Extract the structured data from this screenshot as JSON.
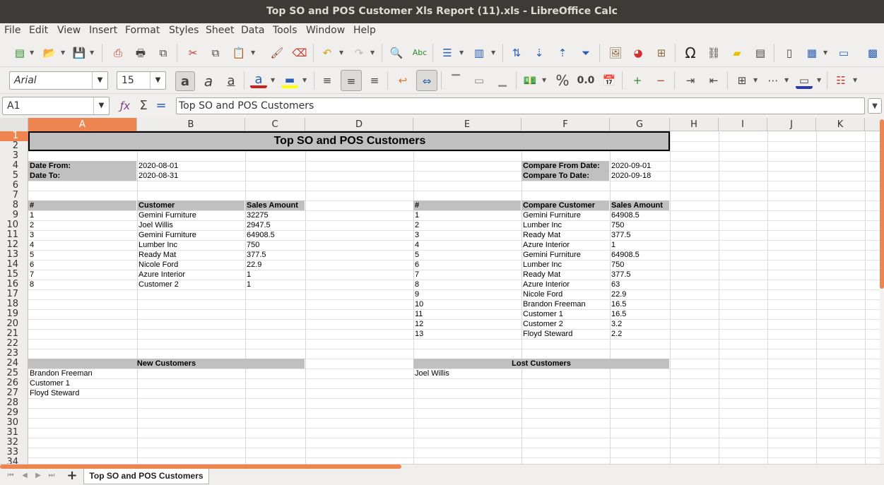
{
  "window": {
    "title": "Top SO and POS Customer Xls Report (11).xls - LibreOffice Calc"
  },
  "menu": [
    "File",
    "Edit",
    "View",
    "Insert",
    "Format",
    "Styles",
    "Sheet",
    "Data",
    "Tools",
    "Window",
    "Help"
  ],
  "font": {
    "name": "Arial",
    "size": "15"
  },
  "number_format": {
    "percent": "%",
    "decimal": "0.0"
  },
  "formula_bar": {
    "cell_ref": "A1",
    "content": "Top SO and POS Customers"
  },
  "columns": [
    "A",
    "B",
    "C",
    "D",
    "E",
    "F",
    "G",
    "H",
    "I",
    "J",
    "K"
  ],
  "rows": [
    "1",
    "2",
    "3",
    "4",
    "5",
    "6",
    "7",
    "8",
    "9",
    "10",
    "11",
    "12",
    "13",
    "14",
    "15",
    "16",
    "17",
    "18",
    "19",
    "20",
    "21",
    "22",
    "23",
    "24",
    "25",
    "26",
    "27",
    "28",
    "29",
    "30",
    "31",
    "32",
    "33",
    "34"
  ],
  "sheet": {
    "title": "Top SO and POS Customers",
    "date_from_label": "Date From:",
    "date_from": "2020-08-01",
    "date_to_label": "Date To:",
    "date_to": "2020-08-31",
    "compare_from_label": "Compare From Date:",
    "compare_from": "2020-09-01",
    "compare_to_label": "Compare To Date:",
    "compare_to": "2020-09-18",
    "left_headers": [
      "#",
      "Customer",
      "Sales Amount"
    ],
    "left_rows": [
      [
        "1",
        "Gemini Furniture",
        "32275"
      ],
      [
        "2",
        "Joel Willis",
        "2947.5"
      ],
      [
        "3",
        "Gemini Furniture",
        "64908.5"
      ],
      [
        "4",
        "Lumber Inc",
        "750"
      ],
      [
        "5",
        "Ready Mat",
        "377.5"
      ],
      [
        "6",
        "Nicole Ford",
        "22.9"
      ],
      [
        "7",
        "Azure Interior",
        "1"
      ],
      [
        "8",
        "Customer 2",
        "1"
      ]
    ],
    "right_headers": [
      "#",
      "Compare Customer",
      "Sales Amount"
    ],
    "right_rows": [
      [
        "1",
        "Gemini Furniture",
        "64908.5"
      ],
      [
        "2",
        "Lumber Inc",
        "750"
      ],
      [
        "3",
        "Ready Mat",
        "377.5"
      ],
      [
        "4",
        "Azure Interior",
        "1"
      ],
      [
        "5",
        "Gemini Furniture",
        "64908.5"
      ],
      [
        "6",
        "Lumber Inc",
        "750"
      ],
      [
        "7",
        "Ready Mat",
        "377.5"
      ],
      [
        "8",
        "Azure Interior",
        "63"
      ],
      [
        "9",
        "Nicole Ford",
        "22.9"
      ],
      [
        "10",
        "Brandon Freeman",
        "16.5"
      ],
      [
        "11",
        "Customer 1",
        "16.5"
      ],
      [
        "12",
        "Customer 2",
        "3.2"
      ],
      [
        "13",
        "Floyd Steward",
        "2.2"
      ]
    ],
    "new_customers_label": "New Customers",
    "new_customers": [
      "Brandon Freeman",
      "Customer 1",
      "Floyd Steward"
    ],
    "lost_customers_label": "Lost Customers",
    "lost_customers": [
      "Joel Willis"
    ]
  },
  "sheet_tab": "Top SO and POS Customers",
  "colors": {
    "accent": "#ee8550",
    "header_gray": "#c0c0c0",
    "titlebar": "#3c3b37"
  }
}
